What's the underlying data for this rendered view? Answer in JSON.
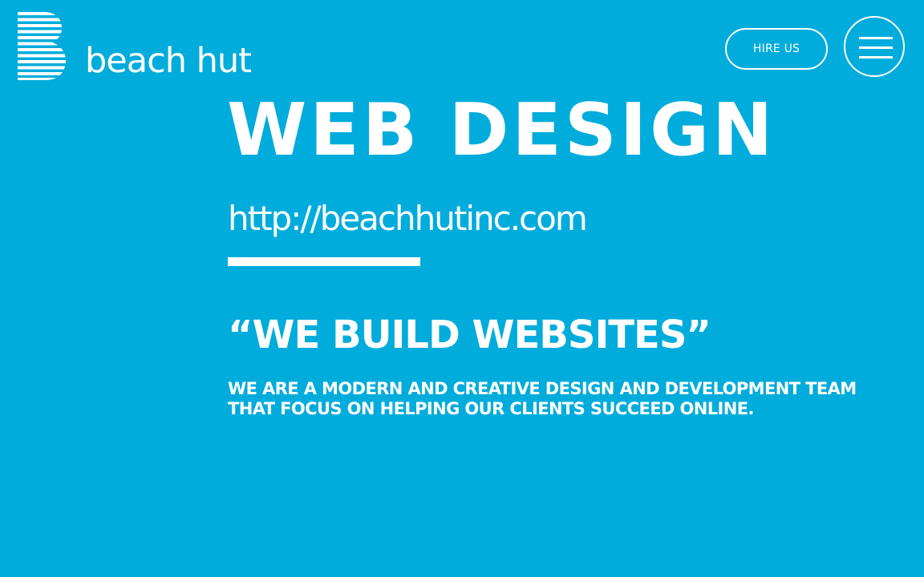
{
  "header": {
    "logo_text": "beach hut",
    "hire_label": "HIRE US",
    "menu_icon": "hamburger-menu-icon",
    "logo_icon": "striped-b-logo-icon"
  },
  "hero": {
    "title": "WEB DESIGN",
    "url": "http://beachhutinc.com",
    "tagline": "“WE BUILD WEBSITES”",
    "description": "WE ARE A MODERN AND CREATIVE DESIGN AND DEVELOPMENT TEAM THAT FOCUS ON HELPING OUR CLIENTS SUCCEED ONLINE."
  },
  "colors": {
    "background": "#00acdc",
    "foreground": "#ffffff"
  }
}
